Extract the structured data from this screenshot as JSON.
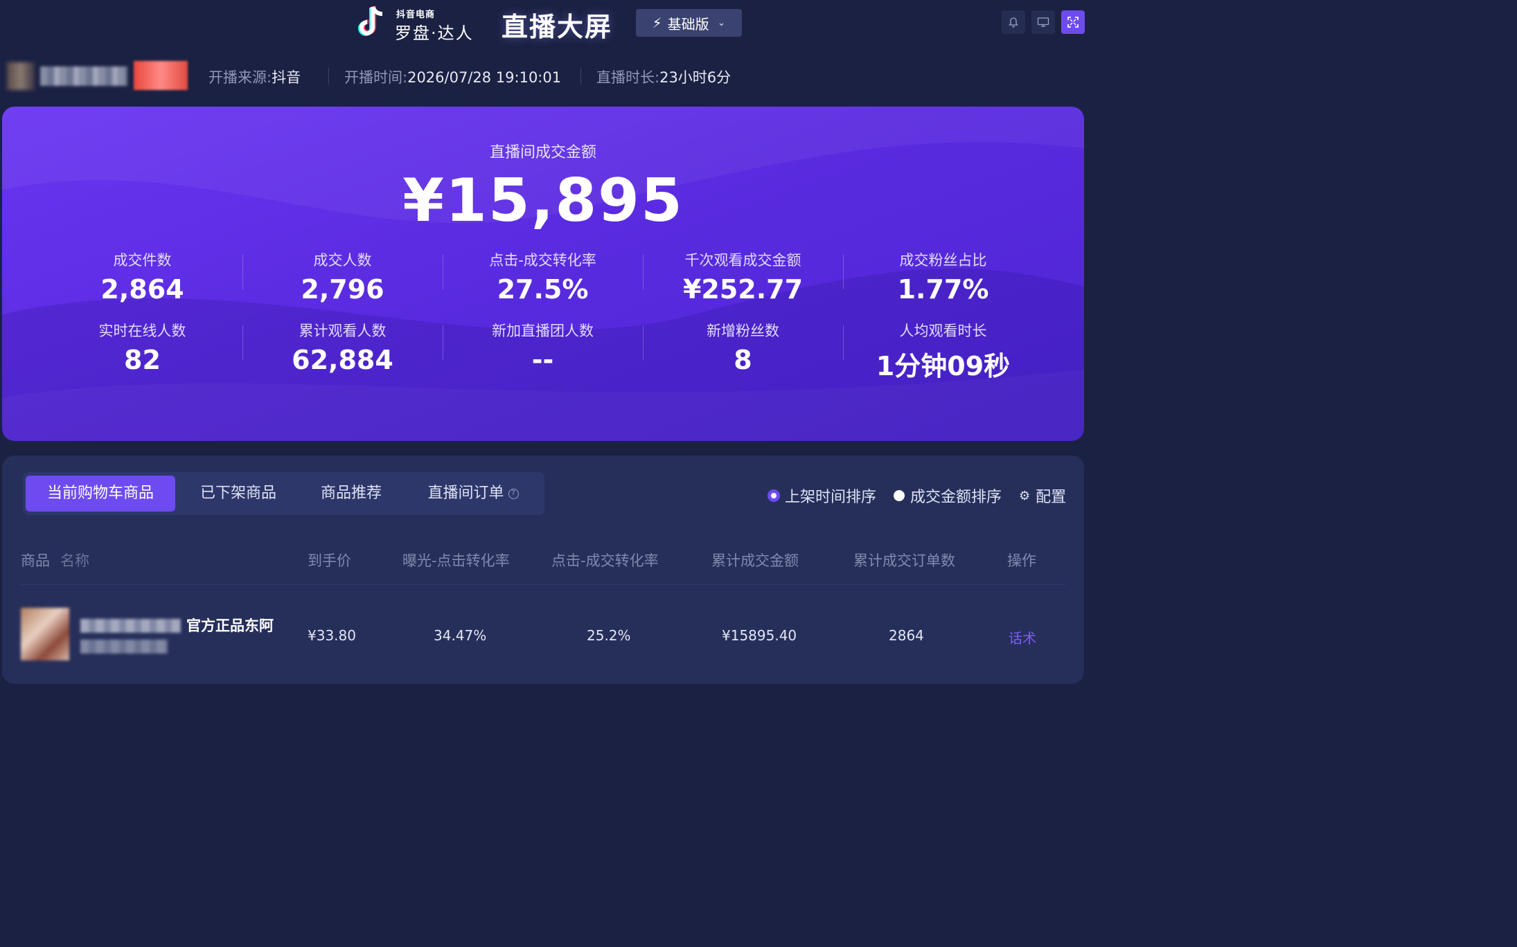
{
  "header": {
    "logo_sub": "抖音电商",
    "logo_main": "罗盘·达人",
    "title": "直播大屏",
    "edition": "基础版",
    "icons": [
      "bell-icon",
      "monitor-icon",
      "fullscreen-icon"
    ]
  },
  "info": {
    "source_label": "开播来源:",
    "source_value": "抖音",
    "start_label": "开播时间:",
    "start_value": "2026/07/28 19:10:01",
    "duration_label": "直播时长:",
    "duration_value": "23小时6分"
  },
  "hero": {
    "label": "直播间成交金额",
    "amount": "¥15,895",
    "stats": [
      {
        "label": "成交件数",
        "value": "2,864"
      },
      {
        "label": "成交人数",
        "value": "2,796"
      },
      {
        "label": "点击-成交转化率",
        "value": "27.5%"
      },
      {
        "label": "千次观看成交金额",
        "value": "¥252.77"
      },
      {
        "label": "成交粉丝占比",
        "value": "1.77%"
      },
      {
        "label": "实时在线人数",
        "value": "82"
      },
      {
        "label": "累计观看人数",
        "value": "62,884"
      },
      {
        "label": "新加直播团人数",
        "value": "--"
      },
      {
        "label": "新增粉丝数",
        "value": "8"
      },
      {
        "label": "人均观看时长",
        "value": "1分钟09秒"
      }
    ]
  },
  "products": {
    "tabs": [
      {
        "label": "当前购物车商品",
        "active": true
      },
      {
        "label": "已下架商品",
        "active": false
      },
      {
        "label": "商品推荐",
        "active": false
      },
      {
        "label": "直播间订单",
        "active": false
      }
    ],
    "sort_options": [
      {
        "label": "上架时间排序",
        "selected": true
      },
      {
        "label": "成交金额排序",
        "selected": false
      }
    ],
    "config_label": "配置",
    "columns": [
      "商品",
      "名称",
      "到手价",
      "曝光-点击转化率",
      "点击-成交转化率",
      "累计成交金额",
      "累计成交订单数",
      "操作"
    ],
    "rows": [
      {
        "name": "官方正品东阿",
        "price": "¥33.80",
        "exposure_click_rate": "34.47%",
        "click_deal_rate": "25.2%",
        "total_amount": "¥15895.40",
        "total_orders": "2864",
        "action": "话术"
      }
    ]
  },
  "colors": {
    "background": "#1b2142",
    "accent": "#6d4bf0",
    "hero_gradient_start": "#6a35f2",
    "hero_gradient_end": "#4d26d3",
    "panel": "#262f5a"
  }
}
